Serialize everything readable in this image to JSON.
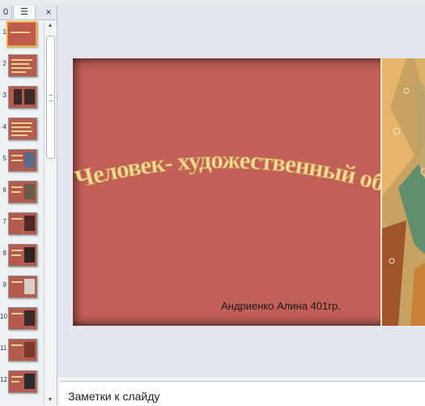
{
  "pane": {
    "tab_slides": "0",
    "tab_outline": "☰",
    "tab_close": "×",
    "thumbnails": [
      "1",
      "2",
      "3",
      "4",
      "5",
      "6",
      "7",
      "8",
      "9",
      "10",
      "11",
      "12"
    ]
  },
  "slide": {
    "title": "Человек- художественный образ",
    "author": "Андриенко Алина 401гр.",
    "background_color": "#c25f58",
    "title_color": "#f2d89a"
  },
  "notes": {
    "placeholder": "Заметки к слайду"
  },
  "icons": [
    "outline-icon",
    "close-icon",
    "scroll-up-icon",
    "scroll-down-icon"
  ]
}
